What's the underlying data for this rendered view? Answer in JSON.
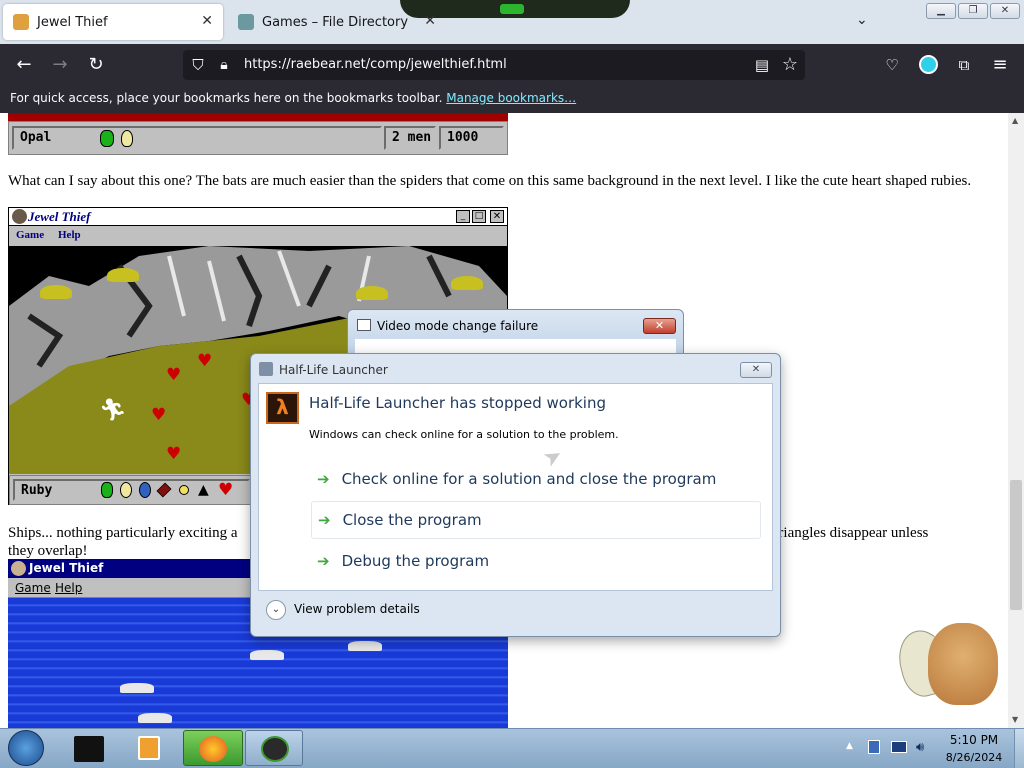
{
  "browser": {
    "tabs": [
      {
        "title": "Jewel Thief",
        "active": true
      },
      {
        "title": "Games – File Directory",
        "active": false
      }
    ],
    "url": "https://raebear.net/comp/jewelthief.html",
    "bookmarks_text": "For quick access, place your bookmarks here on the bookmarks toolbar.",
    "bookmarks_link": "Manage bookmarks…"
  },
  "page": {
    "status1": {
      "gem": "Opal",
      "men": "2 men",
      "score": "1000"
    },
    "para1": "What can I say about this one? The bats are much easier than the spiders that come on this same background in the next level. I like the cute heart shaped rubies.",
    "game1": {
      "title": "Jewel Thief",
      "menu_game": "Game",
      "menu_help": "Help",
      "status_gem": "Ruby"
    },
    "para2_left": "Ships... nothing particularly exciting a",
    "para2_right": "nyx triangles disappear unless",
    "para2_line2": "they overlap!",
    "game2": {
      "title": "Jewel Thief",
      "menu_game": "Game",
      "menu_help": "Help"
    }
  },
  "dialogs": {
    "video": {
      "title": "Video mode change failure"
    },
    "halflife": {
      "window_title": "Half-Life Launcher",
      "heading": "Half-Life Launcher has stopped working",
      "message": "Windows can check online for a solution to the problem.",
      "options": [
        "Check online for a solution and close the program",
        "Close the program",
        "Debug the program"
      ],
      "details": "View problem details"
    }
  },
  "taskbar": {
    "time": "5:10 PM",
    "date": "8/26/2024"
  },
  "colors": {
    "firefox_dark": "#2b2a33",
    "win98_title": "#000080",
    "hl_heading": "#1e395b",
    "link": "#80ebff"
  }
}
